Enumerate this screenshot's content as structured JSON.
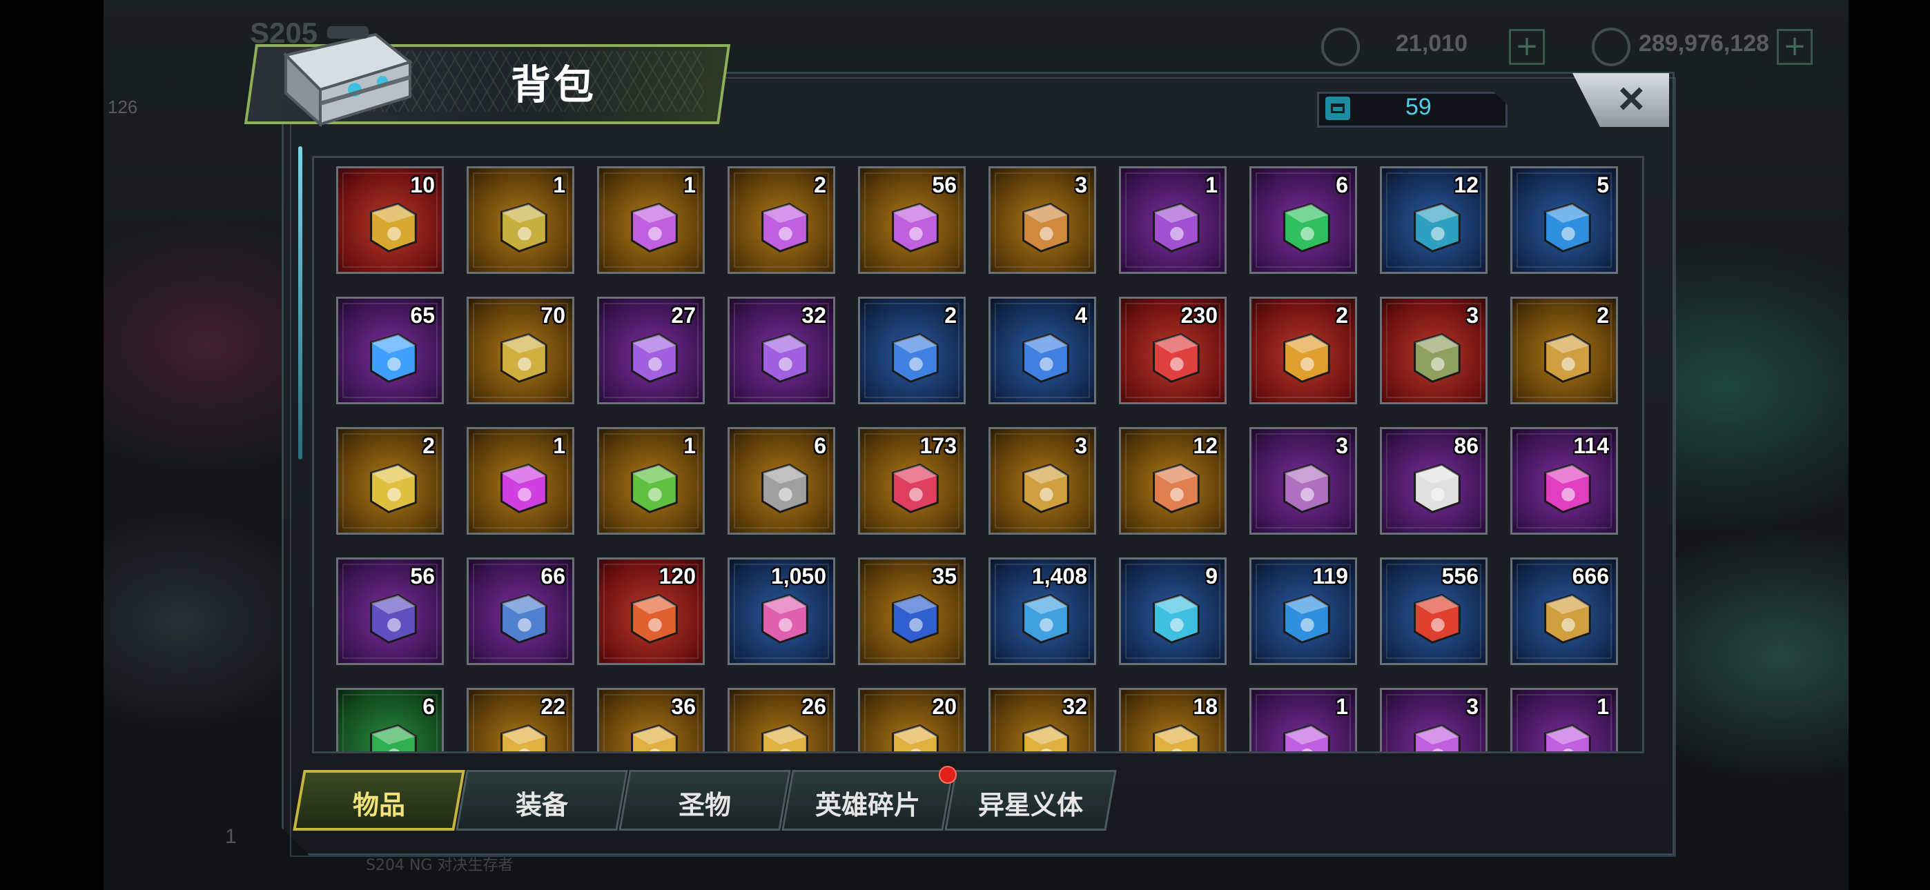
{
  "hud": {
    "server_label": "S205",
    "level": "126",
    "res1_value": "21,010",
    "res2_value": "289,976,128",
    "bottom_number": "1",
    "bottom_text": "S204 NG 对决生存者"
  },
  "window": {
    "title": "背包",
    "capacity_value": "59",
    "close_label": "×"
  },
  "items": [
    {
      "count": "10",
      "rarity": "red",
      "icon": "gold-chest-ii-icon",
      "color": "#d8a830"
    },
    {
      "count": "1",
      "rarity": "gold",
      "icon": "gold-chest-vi-icon",
      "color": "#c8b040"
    },
    {
      "count": "1",
      "rarity": "gold",
      "icon": "crystal-chest-lv3-icon",
      "color": "#c060e0"
    },
    {
      "count": "2",
      "rarity": "gold",
      "icon": "crystal-chest-lv2-icon",
      "color": "#c060e0"
    },
    {
      "count": "56",
      "rarity": "gold",
      "icon": "crystal-chest-lv1-icon",
      "color": "#c060e0"
    },
    {
      "count": "3",
      "rarity": "gold",
      "icon": "steel-crate-icon",
      "color": "#d08a40"
    },
    {
      "count": "1",
      "rarity": "purple",
      "icon": "purple-crate-iv-icon",
      "color": "#a050d0"
    },
    {
      "count": "6",
      "rarity": "purple",
      "icon": "chained-crate-ss-icon",
      "color": "#30c060"
    },
    {
      "count": "12",
      "rarity": "blue",
      "icon": "chained-crate-s-icon",
      "color": "#30a0c0"
    },
    {
      "count": "5",
      "rarity": "blue",
      "icon": "blue-crate-iv-icon",
      "color": "#3090e0"
    },
    {
      "count": "65",
      "rarity": "purple",
      "icon": "blue-swirl-device-icon",
      "color": "#40a0ff"
    },
    {
      "count": "70",
      "rarity": "gold",
      "icon": "speedup-24h-icon",
      "color": "#d0b040"
    },
    {
      "count": "27",
      "rarity": "purple",
      "icon": "speedup-12h-purple-icon",
      "color": "#a060e0"
    },
    {
      "count": "32",
      "rarity": "purple",
      "icon": "speedup-12h-icon",
      "color": "#a060e0"
    },
    {
      "count": "2",
      "rarity": "blue",
      "icon": "speedup-4h-blue-icon",
      "color": "#4080e0"
    },
    {
      "count": "4",
      "rarity": "blue",
      "icon": "speedup-4h-icon",
      "color": "#4080e0"
    },
    {
      "count": "230",
      "rarity": "red",
      "icon": "red-ticket-icon",
      "color": "#e04040"
    },
    {
      "count": "2",
      "rarity": "red",
      "icon": "gold-cube-red-icon",
      "color": "#e0a030"
    },
    {
      "count": "3",
      "rarity": "red",
      "icon": "war-hammer-icon",
      "color": "#90a060"
    },
    {
      "count": "2",
      "rarity": "gold",
      "icon": "gold-cube-icon",
      "color": "#d0a040"
    },
    {
      "count": "2",
      "rarity": "gold",
      "icon": "gold-shard-icon",
      "color": "#e0c040"
    },
    {
      "count": "1",
      "rarity": "gold",
      "icon": "purple-orb-icon",
      "color": "#d040e0"
    },
    {
      "count": "1",
      "rarity": "gold",
      "icon": "green-emblem-icon",
      "color": "#60c040"
    },
    {
      "count": "6",
      "rarity": "gold",
      "icon": "mechanical-core-icon",
      "color": "#a0a0a0"
    },
    {
      "count": "173",
      "rarity": "gold",
      "icon": "red-lips-cap-icon",
      "color": "#e04060"
    },
    {
      "count": "3",
      "rarity": "gold",
      "icon": "golden-gyro-icon",
      "color": "#d0a040"
    },
    {
      "count": "12",
      "rarity": "gold",
      "icon": "thanksgiving-card-icon",
      "color": "#e08050"
    },
    {
      "count": "3",
      "rarity": "purple",
      "icon": "purple-cube-icon",
      "color": "#b070c0"
    },
    {
      "count": "86",
      "rarity": "purple",
      "icon": "film-reel-icon",
      "color": "#e0e0e0"
    },
    {
      "count": "114",
      "rarity": "purple",
      "icon": "pink-cap-icon",
      "color": "#e040c0"
    },
    {
      "count": "56",
      "rarity": "purple",
      "icon": "spade-chip-icon",
      "color": "#6050c0"
    },
    {
      "count": "66",
      "rarity": "purple",
      "icon": "police-badge-icon",
      "color": "#5080d0"
    },
    {
      "count": "120",
      "rarity": "red",
      "icon": "s02-ticket-icon",
      "color": "#e06030"
    },
    {
      "count": "1,050",
      "rarity": "blue",
      "icon": "pink-pass-icon",
      "color": "#e060b0"
    },
    {
      "count": "35",
      "rarity": "gold",
      "icon": "blueberries-icon",
      "color": "#3060d0"
    },
    {
      "count": "1,408",
      "rarity": "blue",
      "icon": "cinema-ticket-icon",
      "color": "#40a0e0"
    },
    {
      "count": "9",
      "rarity": "blue",
      "icon": "timer-device-icon",
      "color": "#40c0e0"
    },
    {
      "count": "119",
      "rarity": "blue",
      "icon": "b-cap-icon",
      "color": "#3090e0"
    },
    {
      "count": "556",
      "rarity": "blue",
      "icon": "red-chip-icon",
      "color": "#e04030"
    },
    {
      "count": "666",
      "rarity": "blue",
      "icon": "bullet-icon",
      "color": "#d0a040"
    },
    {
      "count": "6",
      "rarity": "green",
      "icon": "green-fingerprint-icon",
      "color": "#30b050"
    },
    {
      "count": "22",
      "rarity": "gold",
      "icon": "gold-blueprint-icon",
      "color": "#e0b040"
    },
    {
      "count": "36",
      "rarity": "gold",
      "icon": "gold-blueprint-icon",
      "color": "#e0b040"
    },
    {
      "count": "26",
      "rarity": "gold",
      "icon": "gold-blueprint-icon",
      "color": "#e0b040"
    },
    {
      "count": "20",
      "rarity": "gold",
      "icon": "gold-blueprint-icon",
      "color": "#e0b040"
    },
    {
      "count": "32",
      "rarity": "gold",
      "icon": "gold-blueprint-icon",
      "color": "#e0b040"
    },
    {
      "count": "18",
      "rarity": "gold",
      "icon": "gold-blueprint-icon",
      "color": "#e0b040"
    },
    {
      "count": "1",
      "rarity": "purple",
      "icon": "purple-blueprint-icon",
      "color": "#c060e0"
    },
    {
      "count": "3",
      "rarity": "purple",
      "icon": "purple-blueprint-icon",
      "color": "#c060e0"
    },
    {
      "count": "1",
      "rarity": "purple",
      "icon": "purple-blueprint-icon",
      "color": "#c060e0"
    }
  ],
  "tabs": [
    {
      "label": "物品",
      "active": true
    },
    {
      "label": "装备",
      "active": false
    },
    {
      "label": "圣物",
      "active": false
    },
    {
      "label": "英雄碎片",
      "active": false,
      "badge": true
    },
    {
      "label": "异星义体",
      "active": false
    }
  ]
}
